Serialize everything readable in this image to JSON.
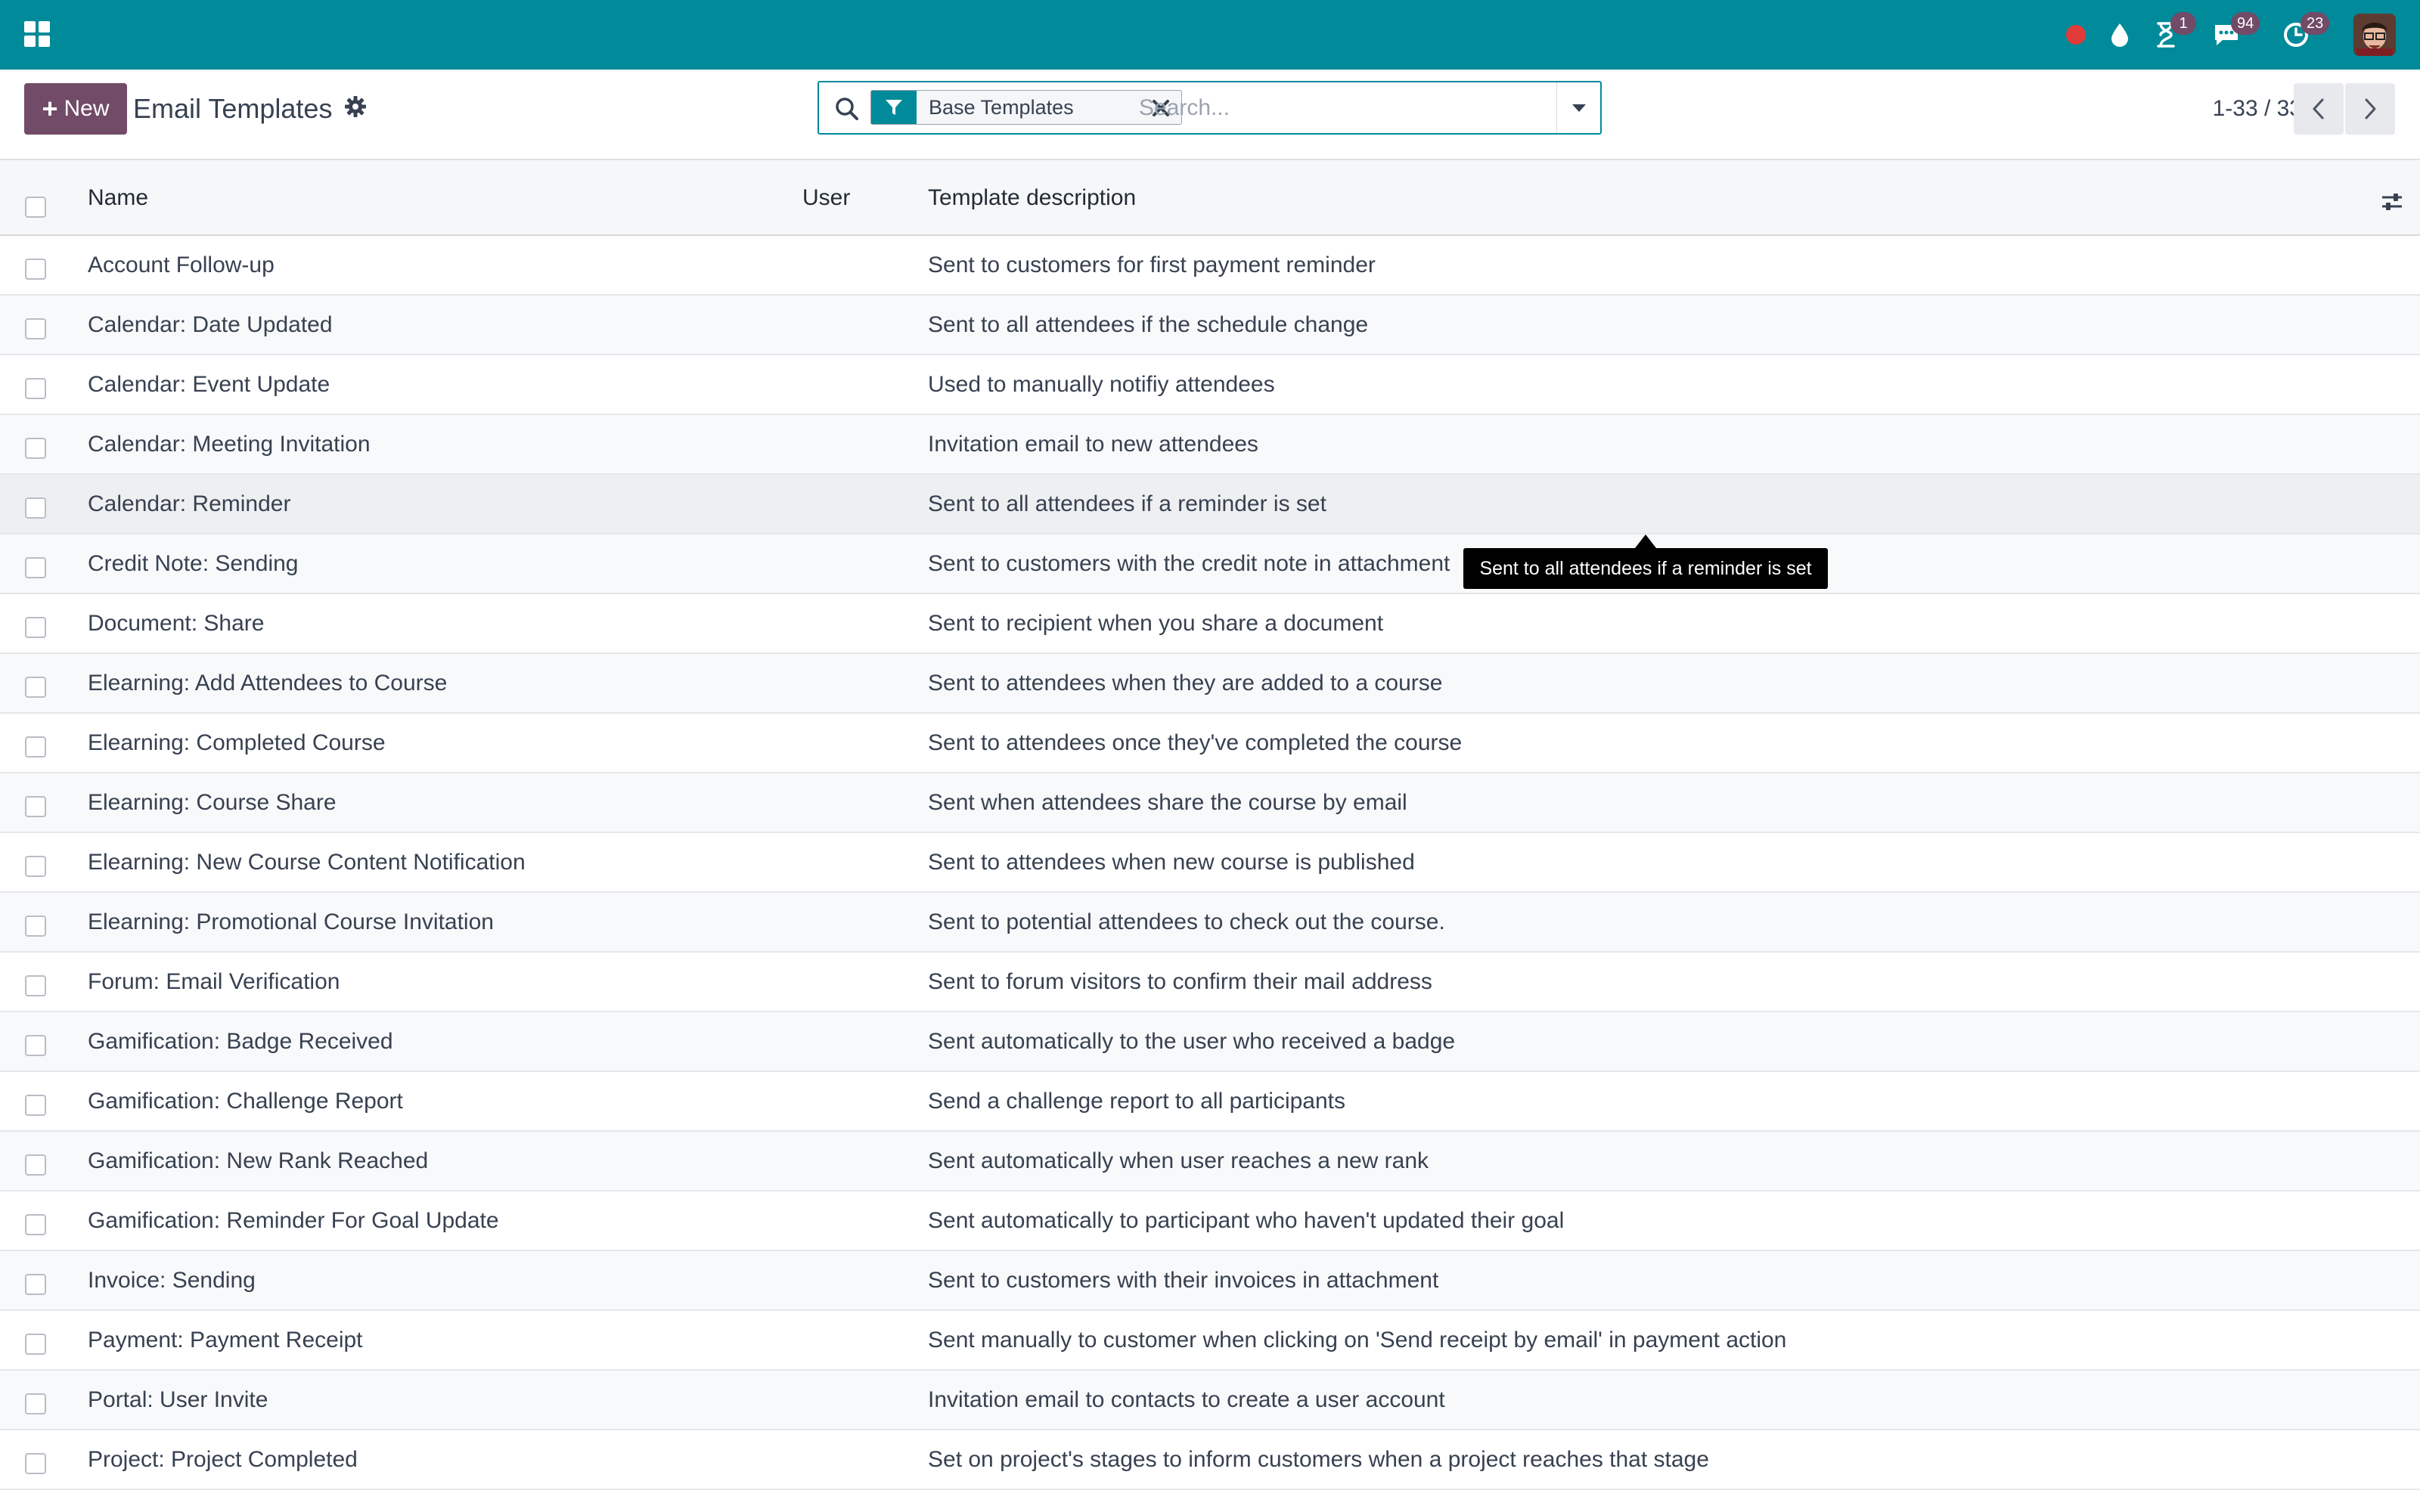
{
  "navbar": {
    "color": "#018a99",
    "systray": [
      {
        "name": "recording-indicator",
        "badge": ""
      },
      {
        "name": "droplet-icon",
        "badge": ""
      },
      {
        "name": "activity-icon",
        "badge": "1"
      },
      {
        "name": "messages-icon",
        "badge": "94"
      },
      {
        "name": "clock-icon",
        "badge": "23"
      }
    ]
  },
  "control_panel": {
    "new_label": "New",
    "title": "Email Templates",
    "search": {
      "facet": "Base Templates",
      "placeholder": "Search..."
    },
    "pager": "1-33 / 33"
  },
  "table": {
    "columns": {
      "name": "Name",
      "user": "User",
      "description": "Template description"
    },
    "rows": [
      {
        "name": "Account Follow-up",
        "description": "Sent to customers for first payment reminder"
      },
      {
        "name": "Calendar: Date Updated",
        "description": "Sent to all attendees if the schedule change"
      },
      {
        "name": "Calendar: Event Update",
        "description": "Used to manually notifiy attendees"
      },
      {
        "name": "Calendar: Meeting Invitation",
        "description": "Invitation email to new attendees"
      },
      {
        "name": "Calendar: Reminder",
        "description": "Sent to all attendees if a reminder is set"
      },
      {
        "name": "Credit Note: Sending",
        "description": "Sent to customers with the credit note in attachment"
      },
      {
        "name": "Document: Share",
        "description": "Sent to recipient when you share a document"
      },
      {
        "name": "Elearning: Add Attendees to Course",
        "description": "Sent to attendees when they are added to a course"
      },
      {
        "name": "Elearning: Completed Course",
        "description": "Sent to attendees once they've completed the course"
      },
      {
        "name": "Elearning: Course Share",
        "description": "Sent when attendees share the course by email"
      },
      {
        "name": "Elearning: New Course Content Notification",
        "description": "Sent to attendees when new course is published"
      },
      {
        "name": "Elearning: Promotional Course Invitation",
        "description": "Sent to potential attendees to check out the course."
      },
      {
        "name": "Forum: Email Verification",
        "description": "Sent to forum visitors to confirm their mail address"
      },
      {
        "name": "Gamification: Badge Received",
        "description": "Sent automatically to the user who received a badge"
      },
      {
        "name": "Gamification: Challenge Report",
        "description": "Send a challenge report to all participants"
      },
      {
        "name": "Gamification: New Rank Reached",
        "description": "Sent automatically when user reaches a new rank"
      },
      {
        "name": "Gamification: Reminder For Goal Update",
        "description": "Sent automatically to participant who haven't updated their goal"
      },
      {
        "name": "Invoice: Sending",
        "description": "Sent to customers with their invoices in attachment"
      },
      {
        "name": "Payment: Payment Receipt",
        "description": "Sent manually to customer when clicking on 'Send receipt by email' in payment action"
      },
      {
        "name": "Portal: User Invite",
        "description": "Invitation email to contacts to create a user account"
      },
      {
        "name": "Project: Project Completed",
        "description": "Set on project's stages to inform customers when a project reaches that stage"
      }
    ]
  },
  "tooltip": {
    "text": "Sent to all attendees if a reminder is set"
  }
}
